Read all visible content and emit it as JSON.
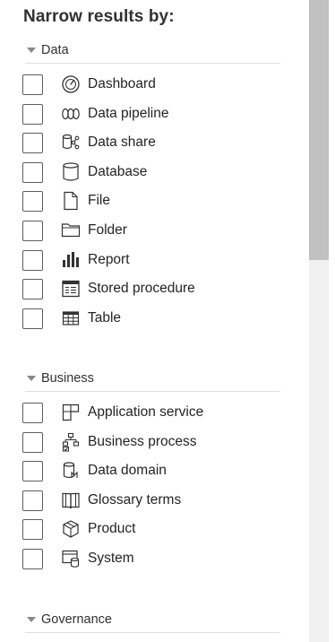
{
  "panel": {
    "title": "Narrow results by:"
  },
  "sections": [
    {
      "label": "Data",
      "expanded": true,
      "items": [
        {
          "label": "Dashboard",
          "icon": "dashboard-icon",
          "checked": false
        },
        {
          "label": "Data pipeline",
          "icon": "data-pipeline-icon",
          "checked": false
        },
        {
          "label": "Data share",
          "icon": "data-share-icon",
          "checked": false
        },
        {
          "label": "Database",
          "icon": "database-icon",
          "checked": false
        },
        {
          "label": "File",
          "icon": "file-icon",
          "checked": false
        },
        {
          "label": "Folder",
          "icon": "folder-icon",
          "checked": false
        },
        {
          "label": "Report",
          "icon": "report-icon",
          "checked": false
        },
        {
          "label": "Stored procedure",
          "icon": "stored-procedure-icon",
          "checked": false
        },
        {
          "label": "Table",
          "icon": "table-icon",
          "checked": false
        }
      ]
    },
    {
      "label": "Business",
      "expanded": true,
      "items": [
        {
          "label": "Application service",
          "icon": "application-service-icon",
          "checked": false
        },
        {
          "label": "Business process",
          "icon": "business-process-icon",
          "checked": false
        },
        {
          "label": "Data domain",
          "icon": "data-domain-icon",
          "checked": false
        },
        {
          "label": "Glossary terms",
          "icon": "glossary-terms-icon",
          "checked": false
        },
        {
          "label": "Product",
          "icon": "product-icon",
          "checked": false
        },
        {
          "label": "System",
          "icon": "system-icon",
          "checked": false
        }
      ]
    },
    {
      "label": "Governance",
      "expanded": true,
      "items": []
    }
  ],
  "colors": {
    "text": "#252423",
    "divider": "#e1dfdd",
    "checkbox_border": "#605e5c",
    "caret": "#8a8886",
    "scroll_track": "#f1f1f1",
    "scroll_thumb": "#c1c1c1"
  }
}
